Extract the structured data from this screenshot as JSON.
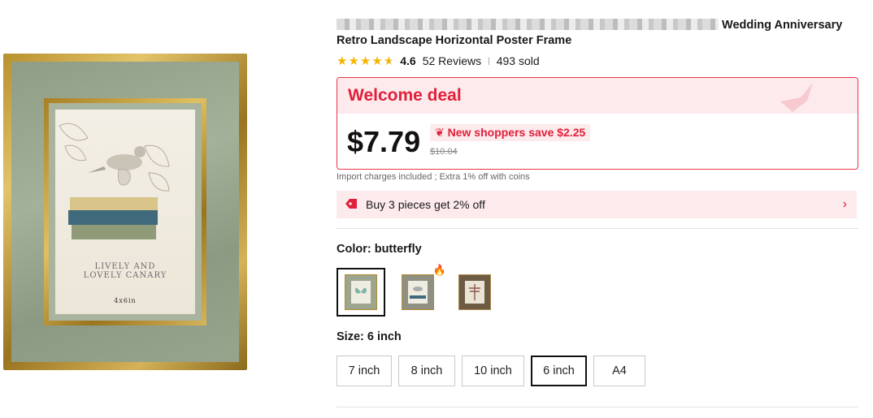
{
  "product": {
    "title_suffix": "Wedding Anniversary",
    "title_line2": "Retro Landscape Horizontal Poster Frame",
    "rating": "4.6",
    "reviews": "52 Reviews",
    "sold": "493 sold",
    "star_color": "#f7b500"
  },
  "artwork": {
    "line1": "LIVELY AND",
    "line2": "LOVELY CANARY",
    "size_text": "4x6in"
  },
  "deal": {
    "title": "Welcome deal",
    "price": "$7.79",
    "save_text": "New shoppers save $2.25",
    "original_price": "$10.04",
    "accent": "#e0203a"
  },
  "import_note": "Import charges included ; Extra 1% off with coins",
  "promo": {
    "text": "Buy 3 pieces get 2% off"
  },
  "color": {
    "label": "Color: butterfly",
    "options": [
      {
        "name": "butterfly",
        "selected": true
      },
      {
        "name": "bird",
        "selected": false,
        "hot": true
      },
      {
        "name": "dragonfly",
        "selected": false
      }
    ]
  },
  "size": {
    "label": "Size: 6 inch",
    "options": [
      "7 inch",
      "8 inch",
      "10 inch",
      "6 inch",
      "A4"
    ],
    "selected": "6 inch"
  }
}
